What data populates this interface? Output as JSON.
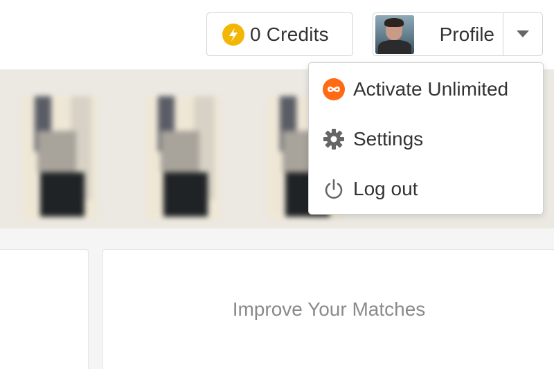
{
  "header": {
    "credits_label": "0 Credits",
    "profile_label": "Profile"
  },
  "profile_menu": {
    "items": [
      {
        "label": "Activate Unlimited",
        "icon": "infinity-icon"
      },
      {
        "label": "Settings",
        "icon": "gear-icon"
      },
      {
        "label": "Log out",
        "icon": "power-icon"
      }
    ]
  },
  "main": {
    "improve_title": "Improve Your Matches"
  },
  "colors": {
    "credits_icon": "#f2b705",
    "unlimited_icon": "#ff6a13",
    "icon_gray": "#666666",
    "text": "#333333",
    "muted_text": "#8a8a8a"
  }
}
